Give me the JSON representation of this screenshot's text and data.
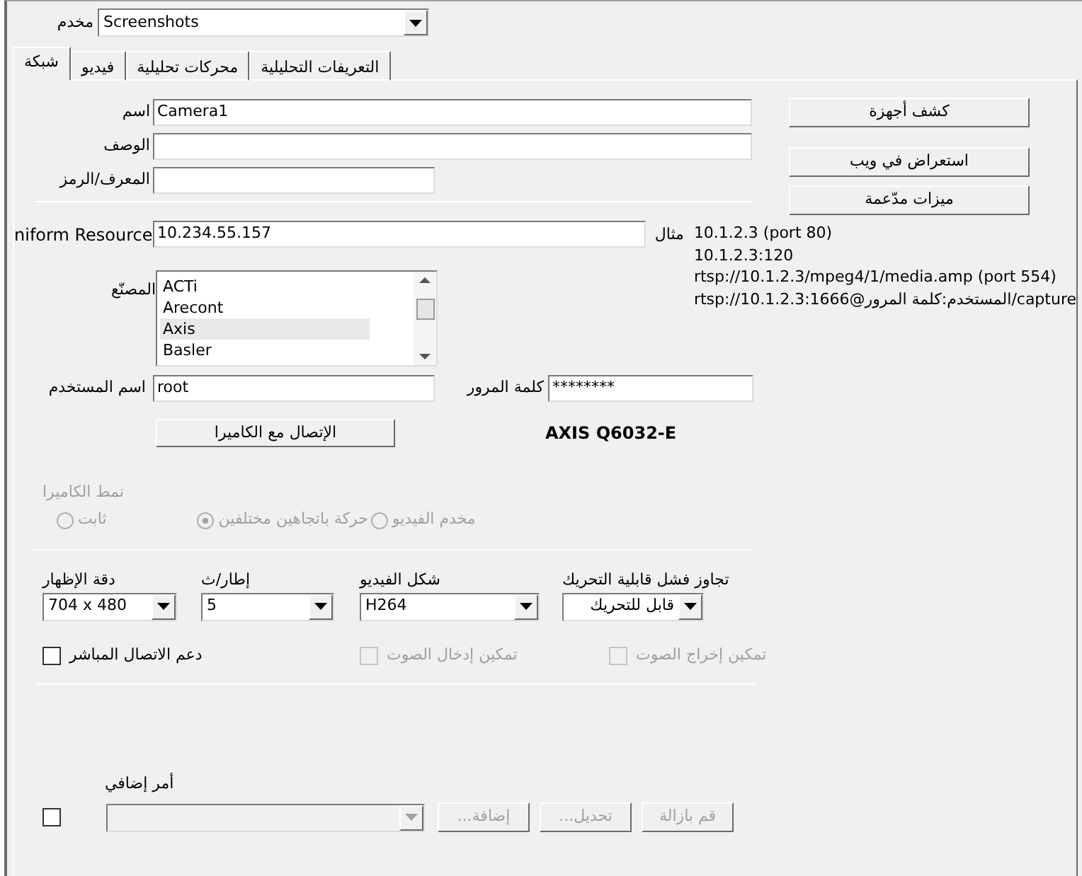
{
  "server": {
    "label": "مخدم",
    "value": "Screenshots"
  },
  "tabs": [
    {
      "label": "التعريفات التحليلية",
      "selected": false
    },
    {
      "label": "محركات تحليلية",
      "selected": false
    },
    {
      "label": "فيديو",
      "selected": false
    },
    {
      "label": "شبكة",
      "selected": true
    }
  ],
  "fields": [
    {
      "label": "اسم",
      "value": "Camera1",
      "kind": "wide"
    },
    {
      "label": "الوصف",
      "kind": "wide"
    },
    {
      "label": "المعرف/الرمز",
      "kind": "narrow"
    }
  ],
  "side_buttons": [
    "كشف أجهزة",
    "استعراض في ويب",
    "ميزات مدّعمة"
  ],
  "url": {
    "label": "niform Resource",
    "value": "10.234.55.157",
    "example_label": "مثال",
    "examples": [
      "10.1.2.3 (port 80)",
      "10.1.2.3:120",
      "rtsp://10.1.2.3/mpeg4/1/media.amp (port 554)",
      "rtsp://المستخدم:كلمة المرور@10.1.2.3:1666/capture"
    ]
  },
  "manufacturer": {
    "label": "المصنّع",
    "items": [
      {
        "label": "ACTi",
        "selected": false
      },
      {
        "label": "Arecont",
        "selected": false
      },
      {
        "label": "Axis",
        "selected": true
      },
      {
        "label": "Basler",
        "selected": false
      }
    ]
  },
  "username": {
    "label": "اسم المستخدم",
    "value": "root"
  },
  "password": {
    "label": "كلمة المرور",
    "value": "********"
  },
  "connect_button": "الإتصال مع الكاميرا",
  "model": "AXIS Q6032-E",
  "camera_mode": {
    "label": "نمط الكاميرا",
    "disabled": true,
    "options": [
      {
        "label": "مخدم الفيديو",
        "selected": false
      },
      {
        "label": "حركة باتجاهين مختلفين",
        "selected": true
      },
      {
        "label": "ثابت",
        "selected": false
      }
    ]
  },
  "video_settings": [
    {
      "label": "تجاوز فشل قابلية التحريك",
      "value": "قابل للتحريك"
    },
    {
      "label": "شكل الفيديو",
      "value": "H264"
    },
    {
      "label": "إطار/ث",
      "value": "5"
    },
    {
      "label": "دقة الإظهار",
      "value": "704 x 480"
    }
  ],
  "checkboxes": [
    {
      "label": "تمكين إخراج الصوت",
      "checked": false,
      "disabled": true
    },
    {
      "label": "تمكين إدخال الصوت",
      "checked": false,
      "disabled": true
    },
    {
      "label": "دعم الاتصال المباشر",
      "checked": false,
      "disabled": false
    }
  ],
  "extra_command": {
    "label": "أمر إضافي",
    "checked": false,
    "disabled": true,
    "buttons": [
      "قم بازالة",
      "تحديل...",
      "إضافة..."
    ]
  }
}
